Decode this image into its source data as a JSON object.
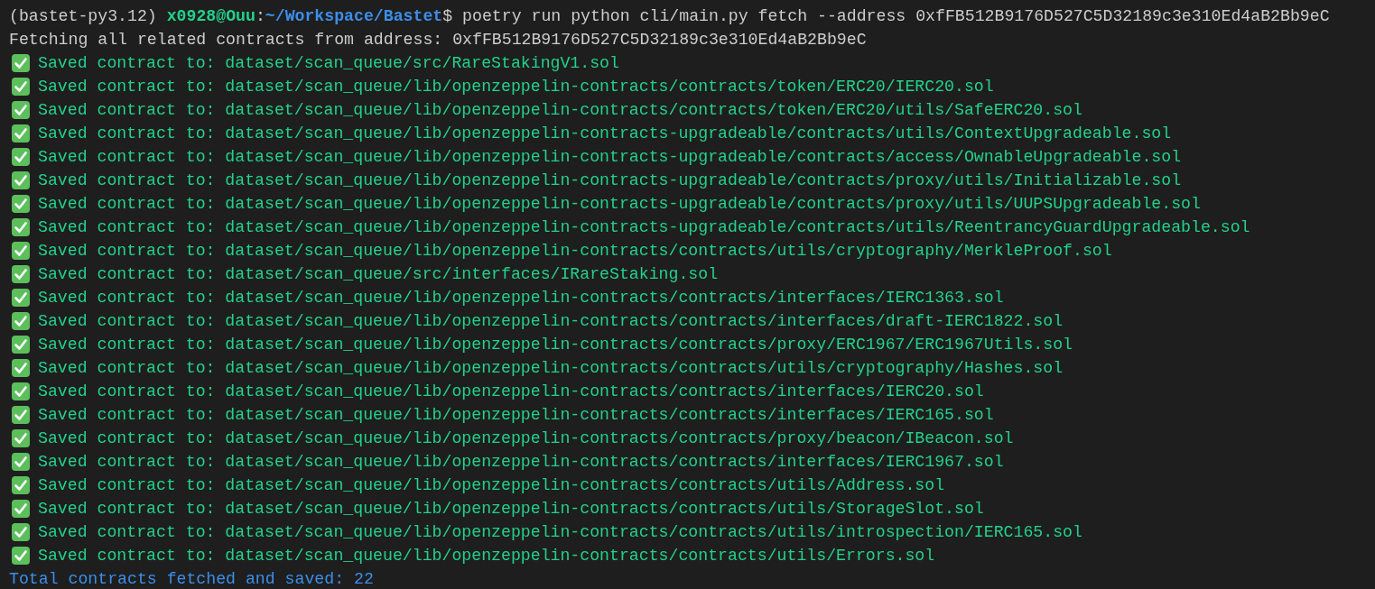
{
  "prompt": {
    "env": "(bastet-py3.12) ",
    "user": "x0928@Ouu",
    "separator": ":",
    "path": "~/Workspace/Bastet",
    "symbol": "$ ",
    "command": "poetry run python cli/main.py fetch --address 0xfFB512B9176D527C5D32189c3e310Ed4aB2Bb9eC"
  },
  "output": [
    {
      "kind": "info",
      "text": "Fetching all related contracts from address: 0xfFB512B9176D527C5D32189c3e310Ed4aB2Bb9eC"
    },
    {
      "kind": "saved",
      "text": "Saved contract to: dataset/scan_queue/src/RareStakingV1.sol"
    },
    {
      "kind": "saved",
      "text": "Saved contract to: dataset/scan_queue/lib/openzeppelin-contracts/contracts/token/ERC20/IERC20.sol"
    },
    {
      "kind": "saved",
      "text": "Saved contract to: dataset/scan_queue/lib/openzeppelin-contracts/contracts/token/ERC20/utils/SafeERC20.sol"
    },
    {
      "kind": "saved",
      "text": "Saved contract to: dataset/scan_queue/lib/openzeppelin-contracts-upgradeable/contracts/utils/ContextUpgradeable.sol"
    },
    {
      "kind": "saved",
      "text": "Saved contract to: dataset/scan_queue/lib/openzeppelin-contracts-upgradeable/contracts/access/OwnableUpgradeable.sol"
    },
    {
      "kind": "saved",
      "text": "Saved contract to: dataset/scan_queue/lib/openzeppelin-contracts-upgradeable/contracts/proxy/utils/Initializable.sol"
    },
    {
      "kind": "saved",
      "text": "Saved contract to: dataset/scan_queue/lib/openzeppelin-contracts-upgradeable/contracts/proxy/utils/UUPSUpgradeable.sol"
    },
    {
      "kind": "saved",
      "text": "Saved contract to: dataset/scan_queue/lib/openzeppelin-contracts-upgradeable/contracts/utils/ReentrancyGuardUpgradeable.sol"
    },
    {
      "kind": "saved",
      "text": "Saved contract to: dataset/scan_queue/lib/openzeppelin-contracts/contracts/utils/cryptography/MerkleProof.sol"
    },
    {
      "kind": "saved",
      "text": "Saved contract to: dataset/scan_queue/src/interfaces/IRareStaking.sol"
    },
    {
      "kind": "saved",
      "text": "Saved contract to: dataset/scan_queue/lib/openzeppelin-contracts/contracts/interfaces/IERC1363.sol"
    },
    {
      "kind": "saved",
      "text": "Saved contract to: dataset/scan_queue/lib/openzeppelin-contracts/contracts/interfaces/draft-IERC1822.sol"
    },
    {
      "kind": "saved",
      "text": "Saved contract to: dataset/scan_queue/lib/openzeppelin-contracts/contracts/proxy/ERC1967/ERC1967Utils.sol"
    },
    {
      "kind": "saved",
      "text": "Saved contract to: dataset/scan_queue/lib/openzeppelin-contracts/contracts/utils/cryptography/Hashes.sol"
    },
    {
      "kind": "saved",
      "text": "Saved contract to: dataset/scan_queue/lib/openzeppelin-contracts/contracts/interfaces/IERC20.sol"
    },
    {
      "kind": "saved",
      "text": "Saved contract to: dataset/scan_queue/lib/openzeppelin-contracts/contracts/interfaces/IERC165.sol"
    },
    {
      "kind": "saved",
      "text": "Saved contract to: dataset/scan_queue/lib/openzeppelin-contracts/contracts/proxy/beacon/IBeacon.sol"
    },
    {
      "kind": "saved",
      "text": "Saved contract to: dataset/scan_queue/lib/openzeppelin-contracts/contracts/interfaces/IERC1967.sol"
    },
    {
      "kind": "saved",
      "text": "Saved contract to: dataset/scan_queue/lib/openzeppelin-contracts/contracts/utils/Address.sol"
    },
    {
      "kind": "saved",
      "text": "Saved contract to: dataset/scan_queue/lib/openzeppelin-contracts/contracts/utils/StorageSlot.sol"
    },
    {
      "kind": "saved",
      "text": "Saved contract to: dataset/scan_queue/lib/openzeppelin-contracts/contracts/utils/introspection/IERC165.sol"
    },
    {
      "kind": "saved",
      "text": "Saved contract to: dataset/scan_queue/lib/openzeppelin-contracts/contracts/utils/Errors.sol"
    },
    {
      "kind": "summary",
      "text": "Total contracts fetched and saved: 22"
    }
  ]
}
